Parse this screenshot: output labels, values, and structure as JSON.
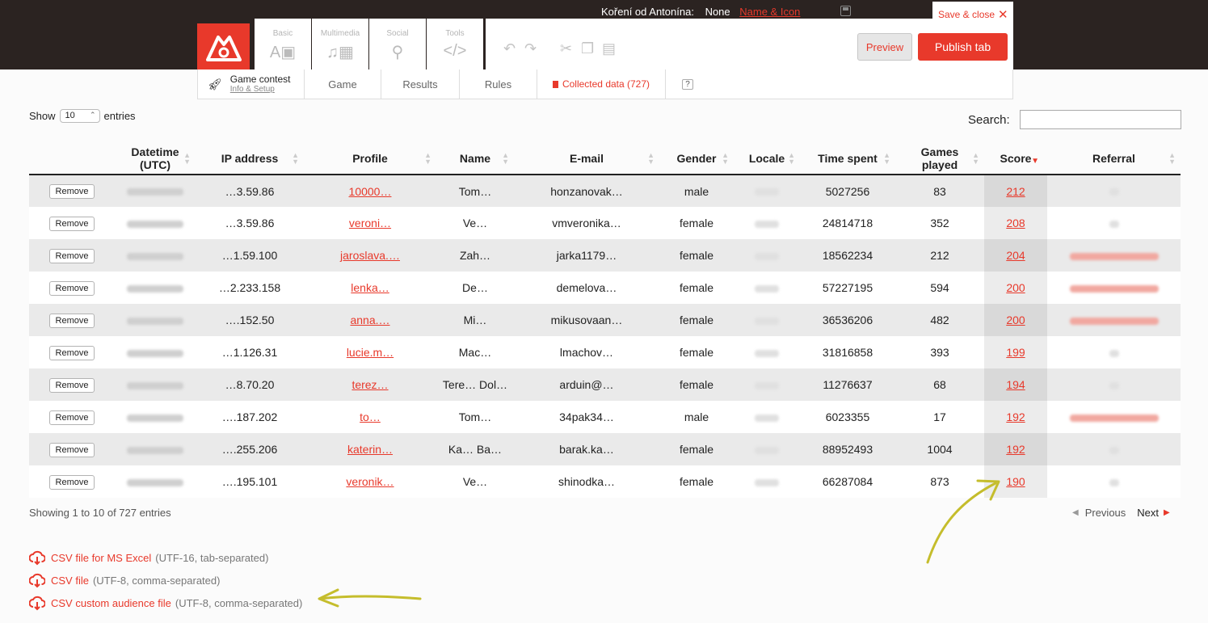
{
  "header": {
    "tab_label": "Koření od Antonína:",
    "tab_value": "None",
    "name_icon_link": "Name & Icon",
    "save_close": "Save & close",
    "preview": "Preview",
    "publish": "Publish tab",
    "tool_tabs": [
      {
        "label": "Basic",
        "icon": "text-image-icon"
      },
      {
        "label": "Multimedia",
        "icon": "media-icon"
      },
      {
        "label": "Social",
        "icon": "social-icon"
      },
      {
        "label": "Tools",
        "icon": "code-icon"
      }
    ]
  },
  "subnav": {
    "game_contest": "Game contest",
    "info_setup": "Info & Setup",
    "items": [
      "Game",
      "Results",
      "Rules"
    ],
    "collected": "Collected data (727)",
    "help": "?"
  },
  "controls": {
    "show_label": "Show",
    "entries_label": "entries",
    "page_size": "10",
    "search_label": "Search:"
  },
  "table": {
    "columns": [
      "Datetime (UTC)",
      "IP address",
      "Profile",
      "Name",
      "E-mail",
      "Gender",
      "Locale",
      "Time spent",
      "Games played",
      "Score",
      "Referral"
    ],
    "remove_label": "Remove",
    "rows": [
      {
        "ip": "…3.59.86",
        "profile": "10000…",
        "name": "Tom…",
        "email": "honzanovak…",
        "gender": "male",
        "time": "5027256",
        "games": "83",
        "score": "212",
        "ref": false
      },
      {
        "ip": "…3.59.86",
        "profile": "veroni…",
        "name": "Ve…",
        "email": "vmveronika…",
        "gender": "female",
        "time": "24814718",
        "games": "352",
        "score": "208",
        "ref": false
      },
      {
        "ip": "…1.59.100",
        "profile": "jaroslava.…",
        "name": "Zah…",
        "email": "jarka1179…",
        "gender": "female",
        "time": "18562234",
        "games": "212",
        "score": "204",
        "ref": true
      },
      {
        "ip": "…2.233.158",
        "profile": "lenka…",
        "name": "De…",
        "email": "demelova…",
        "gender": "female",
        "time": "57227195",
        "games": "594",
        "score": "200",
        "ref": true
      },
      {
        "ip": "….152.50",
        "profile": "anna.…",
        "name": "Mi…",
        "email": "mikusovaan…",
        "gender": "female",
        "time": "36536206",
        "games": "482",
        "score": "200",
        "ref": true
      },
      {
        "ip": "…1.126.31",
        "profile": "lucie.m…",
        "name": "Mac…",
        "email": "lmachov…",
        "gender": "female",
        "time": "31816858",
        "games": "393",
        "score": "199",
        "ref": false
      },
      {
        "ip": "…8.70.20",
        "profile": "terez…",
        "name": "Tere… Dol…",
        "email": "arduin@…",
        "gender": "female",
        "time": "11276637",
        "games": "68",
        "score": "194",
        "ref": false
      },
      {
        "ip": "….187.202",
        "profile": "to…",
        "name": "Tom…",
        "email": "34pak34…",
        "gender": "male",
        "time": "6023355",
        "games": "17",
        "score": "192",
        "ref": true
      },
      {
        "ip": "….255.206",
        "profile": "katerin…",
        "name": "Ka… Ba…",
        "email": "barak.ka…",
        "gender": "female",
        "time": "88952493",
        "games": "1004",
        "score": "192",
        "ref": false
      },
      {
        "ip": "….195.101",
        "profile": "veronik…",
        "name": "Ve…",
        "email": "shinodka…",
        "gender": "female",
        "time": "66287084",
        "games": "873",
        "score": "190",
        "ref": false
      }
    ]
  },
  "footer": {
    "showing": "Showing 1 to 10 of 727 entries",
    "previous": "Previous",
    "next": "Next"
  },
  "downloads": [
    {
      "name": "CSV file for MS Excel",
      "desc": "(UTF-16, tab-separated)"
    },
    {
      "name": "CSV file",
      "desc": "(UTF-8, comma-separated)"
    },
    {
      "name": "CSV custom audience file",
      "desc": "(UTF-8, comma-separated)"
    }
  ],
  "colors": {
    "accent": "#e8392b",
    "topbar": "#2b2321",
    "annotation": "#c5bd2c"
  }
}
